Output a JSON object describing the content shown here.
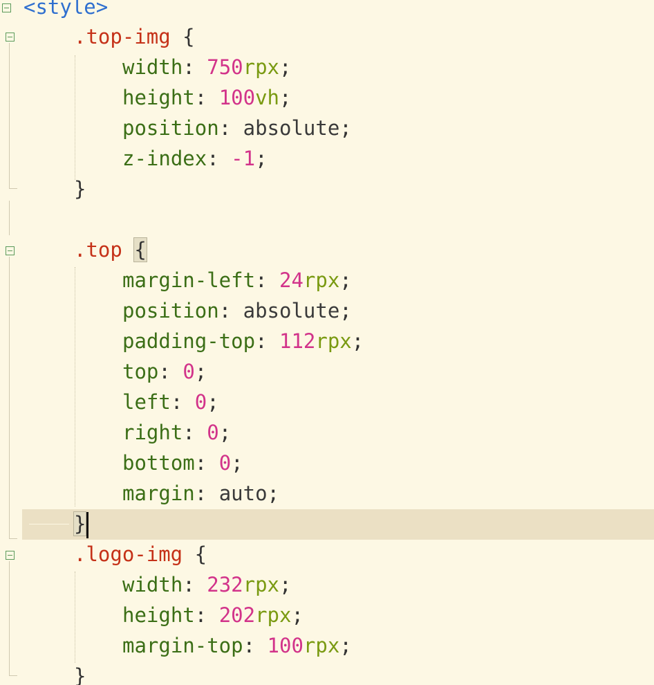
{
  "editor": {
    "lines": [
      {
        "id": "l0",
        "tokens": [
          {
            "t": "tag",
            "v": "<style>"
          }
        ]
      },
      {
        "id": "l1",
        "tokens": [
          {
            "t": "sel",
            "v": ".top-img"
          },
          {
            "t": "punc",
            "v": " {"
          }
        ]
      },
      {
        "id": "l2",
        "tokens": [
          {
            "t": "prop",
            "v": "width"
          },
          {
            "t": "punc",
            "v": ": "
          },
          {
            "t": "num",
            "v": "750"
          },
          {
            "t": "unit",
            "v": "rpx"
          },
          {
            "t": "punc",
            "v": ";"
          }
        ]
      },
      {
        "id": "l3",
        "tokens": [
          {
            "t": "prop",
            "v": "height"
          },
          {
            "t": "punc",
            "v": ": "
          },
          {
            "t": "num",
            "v": "100"
          },
          {
            "t": "unit",
            "v": "vh"
          },
          {
            "t": "punc",
            "v": ";"
          }
        ]
      },
      {
        "id": "l4",
        "tokens": [
          {
            "t": "prop",
            "v": "position"
          },
          {
            "t": "punc",
            "v": ": "
          },
          {
            "t": "val",
            "v": "absolute"
          },
          {
            "t": "punc",
            "v": ";"
          }
        ]
      },
      {
        "id": "l5",
        "tokens": [
          {
            "t": "prop",
            "v": "z-index"
          },
          {
            "t": "punc",
            "v": ": "
          },
          {
            "t": "num",
            "v": "-1"
          },
          {
            "t": "punc",
            "v": ";"
          }
        ]
      },
      {
        "id": "l6",
        "tokens": [
          {
            "t": "punc",
            "v": "}"
          }
        ]
      },
      {
        "id": "l7",
        "tokens": []
      },
      {
        "id": "l8",
        "tokens": [
          {
            "t": "sel",
            "v": ".top"
          },
          {
            "t": "punc",
            "v": " "
          },
          {
            "t": "brace",
            "v": "{"
          }
        ]
      },
      {
        "id": "l9",
        "tokens": [
          {
            "t": "prop",
            "v": "margin-left"
          },
          {
            "t": "punc",
            "v": ": "
          },
          {
            "t": "num",
            "v": "24"
          },
          {
            "t": "unit",
            "v": "rpx"
          },
          {
            "t": "punc",
            "v": ";"
          }
        ]
      },
      {
        "id": "l10",
        "tokens": [
          {
            "t": "prop",
            "v": "position"
          },
          {
            "t": "punc",
            "v": ": "
          },
          {
            "t": "val",
            "v": "absolute"
          },
          {
            "t": "punc",
            "v": ";"
          }
        ]
      },
      {
        "id": "l11",
        "tokens": [
          {
            "t": "prop",
            "v": "padding-top"
          },
          {
            "t": "punc",
            "v": ": "
          },
          {
            "t": "num",
            "v": "112"
          },
          {
            "t": "unit",
            "v": "rpx"
          },
          {
            "t": "punc",
            "v": ";"
          }
        ]
      },
      {
        "id": "l12",
        "tokens": [
          {
            "t": "prop",
            "v": "top"
          },
          {
            "t": "punc",
            "v": ": "
          },
          {
            "t": "num",
            "v": "0"
          },
          {
            "t": "punc",
            "v": ";"
          }
        ]
      },
      {
        "id": "l13",
        "tokens": [
          {
            "t": "prop",
            "v": "left"
          },
          {
            "t": "punc",
            "v": ": "
          },
          {
            "t": "num",
            "v": "0"
          },
          {
            "t": "punc",
            "v": ";"
          }
        ]
      },
      {
        "id": "l14",
        "tokens": [
          {
            "t": "prop",
            "v": "right"
          },
          {
            "t": "punc",
            "v": ": "
          },
          {
            "t": "num",
            "v": "0"
          },
          {
            "t": "punc",
            "v": ";"
          }
        ]
      },
      {
        "id": "l15",
        "tokens": [
          {
            "t": "prop",
            "v": "bottom"
          },
          {
            "t": "punc",
            "v": ": "
          },
          {
            "t": "num",
            "v": "0"
          },
          {
            "t": "punc",
            "v": ";"
          }
        ]
      },
      {
        "id": "l16",
        "tokens": [
          {
            "t": "prop",
            "v": "margin"
          },
          {
            "t": "punc",
            "v": ": "
          },
          {
            "t": "val",
            "v": "auto"
          },
          {
            "t": "punc",
            "v": ";"
          }
        ]
      },
      {
        "id": "l17",
        "tokens": [
          {
            "t": "brace",
            "v": "}"
          }
        ]
      },
      {
        "id": "l18",
        "tokens": [
          {
            "t": "sel",
            "v": ".logo-img"
          },
          {
            "t": "punc",
            "v": " {"
          }
        ]
      },
      {
        "id": "l19",
        "tokens": [
          {
            "t": "prop",
            "v": "width"
          },
          {
            "t": "punc",
            "v": ": "
          },
          {
            "t": "num",
            "v": "232"
          },
          {
            "t": "unit",
            "v": "rpx"
          },
          {
            "t": "punc",
            "v": ";"
          }
        ]
      },
      {
        "id": "l20",
        "tokens": [
          {
            "t": "prop",
            "v": "height"
          },
          {
            "t": "punc",
            "v": ": "
          },
          {
            "t": "num",
            "v": "202"
          },
          {
            "t": "unit",
            "v": "rpx"
          },
          {
            "t": "punc",
            "v": ";"
          }
        ]
      },
      {
        "id": "l21",
        "tokens": [
          {
            "t": "prop",
            "v": "margin-top"
          },
          {
            "t": "punc",
            "v": ": "
          },
          {
            "t": "num",
            "v": "100"
          },
          {
            "t": "unit",
            "v": "rpx"
          },
          {
            "t": "punc",
            "v": ";"
          }
        ]
      },
      {
        "id": "l22",
        "tokens": [
          {
            "t": "punc",
            "v": "}"
          }
        ]
      }
    ]
  },
  "colors": {
    "background": "#fdf8e4",
    "current_line": "#ebe0c4",
    "tag": "#2f6fcf",
    "selector": "#c53118",
    "property": "#3b6e16",
    "number": "#d2338a",
    "unit": "#7a9a12"
  }
}
